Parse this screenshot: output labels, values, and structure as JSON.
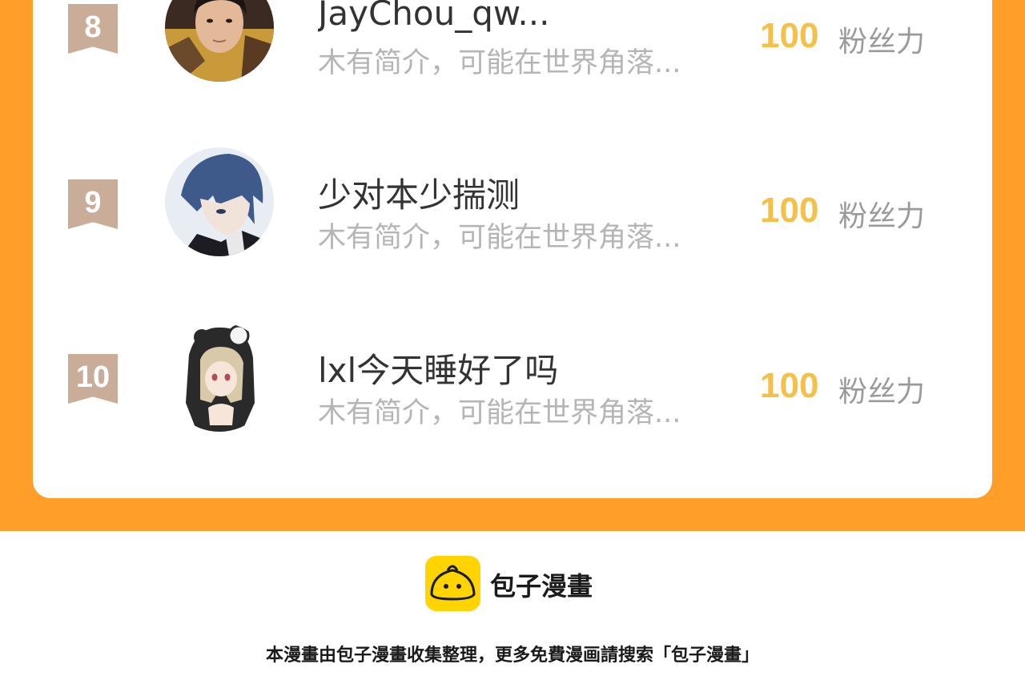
{
  "ranking": {
    "items": [
      {
        "rank": "8",
        "name": "JayChou_qw...",
        "bio": "木有简介，可能在世界角落...",
        "fans": "100",
        "fans_unit": "粉丝力",
        "avatar": "avatar-photo-man"
      },
      {
        "rank": "9",
        "name": "少对本少揣测",
        "bio": "木有简介，可能在世界角落...",
        "fans": "100",
        "fans_unit": "粉丝力",
        "avatar": "avatar-anime-boy"
      },
      {
        "rank": "10",
        "name": "lxl今天睡好了吗",
        "bio": "木有简介，可能在世界角落...",
        "fans": "100",
        "fans_unit": "粉丝力",
        "avatar": "avatar-anime-girl"
      }
    ]
  },
  "footer": {
    "brand": "包子漫畫",
    "note": "本漫畫由包子漫畫收集整理，更多免費漫画請搜索「包子漫畫」"
  },
  "colors": {
    "accent_orange": "#ff9f2a",
    "fans_gold": "#f4c04a",
    "rank_badge": "#c9ad98",
    "logo_yellow": "#ffd400"
  }
}
